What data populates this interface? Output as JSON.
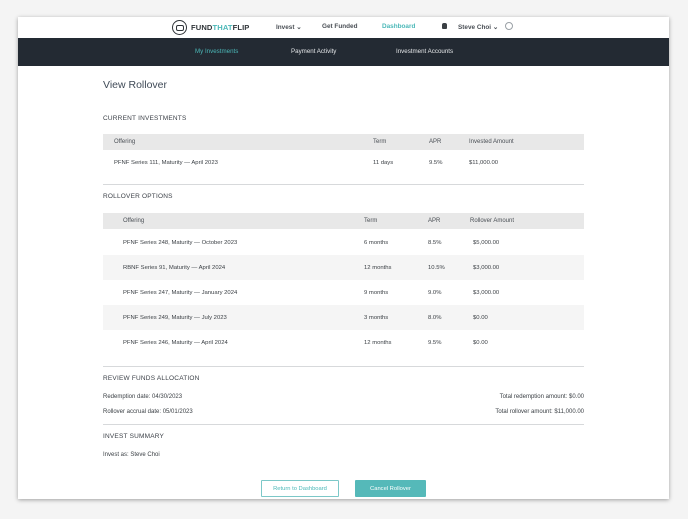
{
  "brand": {
    "name_part1": "FUND",
    "name_accent": "THAT",
    "name_part2": "FLIP",
    "accent_color": "#4bb8b8"
  },
  "topnav": {
    "invest": "Invest",
    "get_funded": "Get Funded",
    "dashboard": "Dashboard",
    "user_name": "Steve Choi"
  },
  "subnav": {
    "items": [
      "My Investments",
      "Payment Activity",
      "Investment Accounts"
    ],
    "active": "My Investments"
  },
  "page": {
    "title": "View Rollover"
  },
  "current_investments": {
    "heading": "CURRENT INVESTMENTS",
    "columns": [
      "Offering",
      "Term",
      "APR",
      "Invested Amount"
    ],
    "rows": [
      {
        "offering": "PFNF Series 111, Maturity — April 2023",
        "term": "11 days",
        "apr": "9.5%",
        "amount": "$11,000.00"
      }
    ]
  },
  "rollover_options": {
    "heading": "ROLLOVER OPTIONS",
    "columns": [
      "Offering",
      "Term",
      "APR",
      "Rollover Amount"
    ],
    "rows": [
      {
        "offering": "PFNF Series 248, Maturity — October 2023",
        "term": "6 months",
        "apr": "8.5%",
        "amount": "$5,000.00"
      },
      {
        "offering": "RBNF Series 91, Maturity — April 2024",
        "term": "12 months",
        "apr": "10.5%",
        "amount": "$3,000.00"
      },
      {
        "offering": "PFNF Series 247, Maturity — January 2024",
        "term": "9 months",
        "apr": "9.0%",
        "amount": "$3,000.00"
      },
      {
        "offering": "PFNF Series 249, Maturity — July 2023",
        "term": "3 months",
        "apr": "8.0%",
        "amount": "$0.00"
      },
      {
        "offering": "PFNF Series 246, Maturity — April 2024",
        "term": "12 months",
        "apr": "9.5%",
        "amount": "$0.00"
      }
    ]
  },
  "review": {
    "heading": "REVIEW FUNDS ALLOCATION",
    "redemption_date_label": "Redemption date:",
    "redemption_date": "04/30/2023",
    "accrual_date_label": "Rollover accrual date:",
    "accrual_date": "05/01/2023",
    "total_redemption_label": "Total redemption amount:",
    "total_redemption": "$0.00",
    "total_rollover_label": "Total rollover amount:",
    "total_rollover": "$11,000.00"
  },
  "summary": {
    "heading": "INVEST SUMMARY",
    "invest_as_label": "Invest as:",
    "invest_as": "Steve Choi"
  },
  "actions": {
    "return": "Return to Dashboard",
    "cancel": "Cancel Rollover"
  }
}
